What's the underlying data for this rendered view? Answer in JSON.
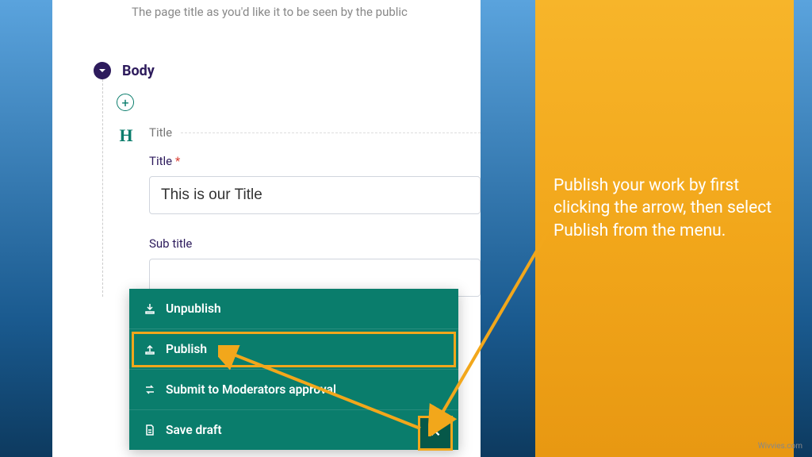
{
  "help": {
    "page_title_hint": "The page title as you'd like it to be seen by the public"
  },
  "body_section": {
    "label": "Body",
    "block_label": "Title",
    "title_field_label": "Title",
    "title_value": "This is our Title",
    "subtitle_label": "Sub title"
  },
  "action_menu": {
    "unpublish": "Unpublish",
    "publish": "Publish",
    "submit": "Submit to Moderators approval",
    "save_draft": "Save draft"
  },
  "annotation": {
    "text": "Publish your work by first clicking the arrow, then select Publish from the menu."
  },
  "brand": "Wivvies"
}
